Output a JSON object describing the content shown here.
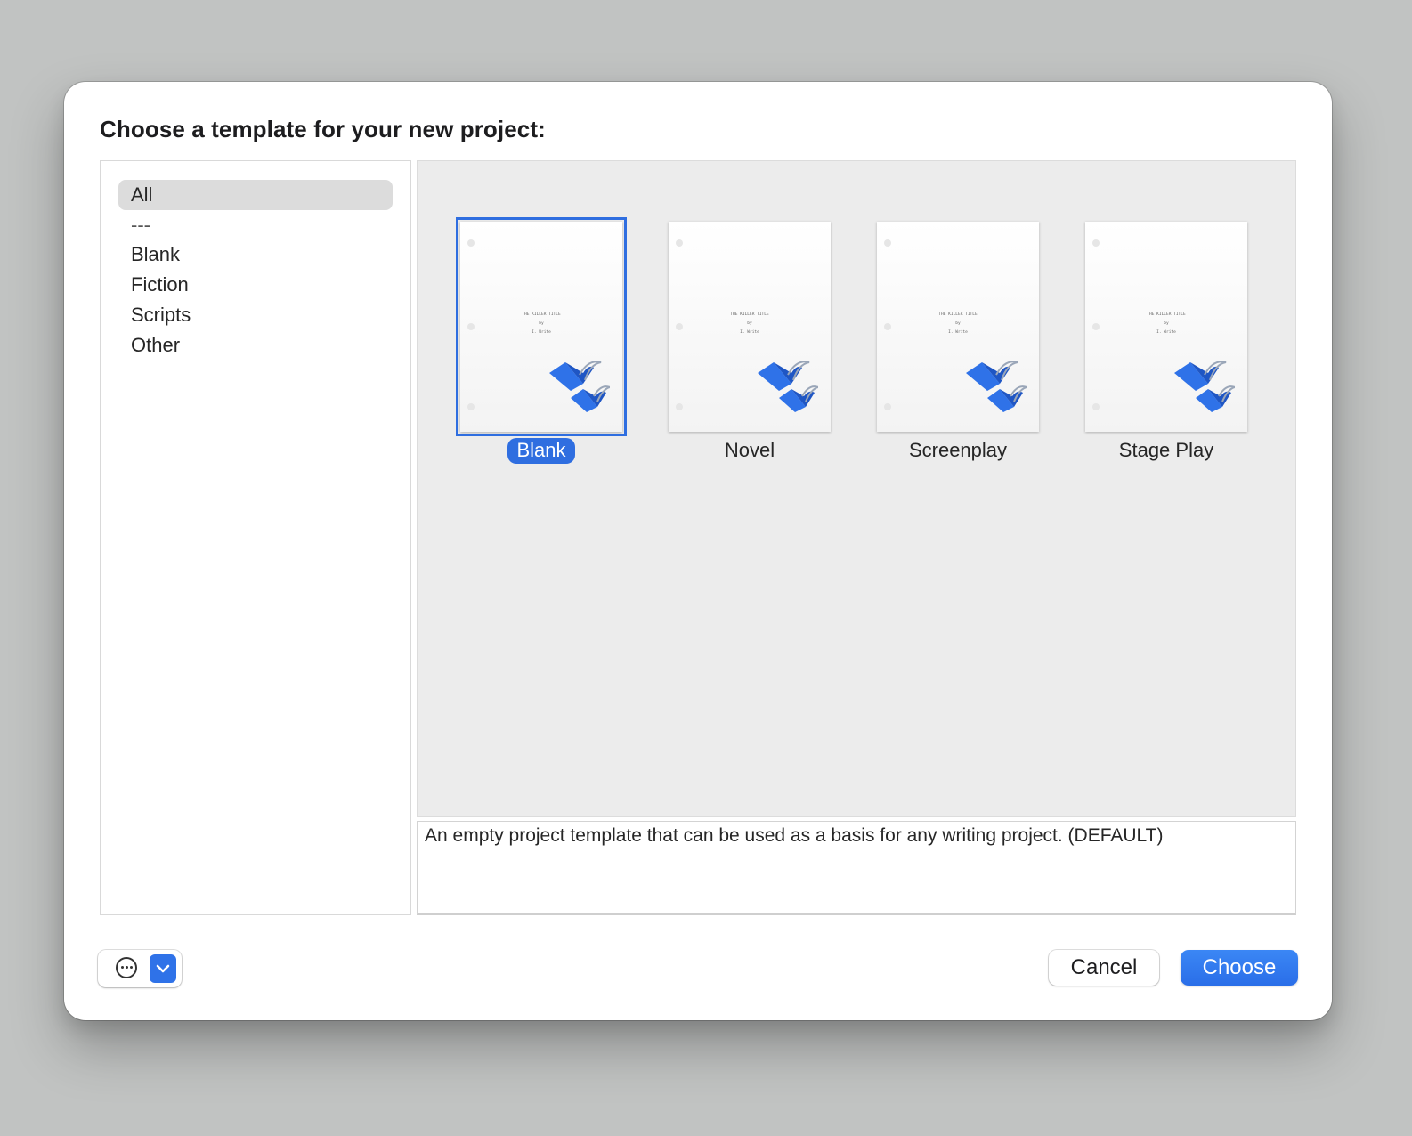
{
  "dialog": {
    "title": "Choose a template for your new project:"
  },
  "sidebar": {
    "categories": [
      {
        "label": "All",
        "selected": true
      },
      {
        "label": "---",
        "selected": false
      },
      {
        "label": "Blank",
        "selected": false
      },
      {
        "label": "Fiction",
        "selected": false
      },
      {
        "label": "Scripts",
        "selected": false
      },
      {
        "label": "Other",
        "selected": false
      }
    ]
  },
  "templates": [
    {
      "label": "Blank",
      "selected": true,
      "page_lines": [
        "THE KILLER TITLE",
        "by",
        "I. Write"
      ]
    },
    {
      "label": "Novel",
      "selected": false,
      "page_lines": [
        "THE KILLER TITLE",
        "by",
        "I. Write"
      ]
    },
    {
      "label": "Screenplay",
      "selected": false,
      "page_lines": [
        "THE KILLER TITLE",
        "by",
        "I. Write"
      ]
    },
    {
      "label": "Stage Play",
      "selected": false,
      "page_lines": [
        "THE KILLER TITLE",
        "by",
        "I. Write"
      ]
    }
  ],
  "description": "An empty project template that can be used as a basis for any writing project. (DEFAULT)",
  "footer": {
    "options_icon": "ellipsis-circle-icon",
    "dropdown_icon": "chevron-down-icon",
    "cancel_label": "Cancel",
    "choose_label": "Choose"
  },
  "colors": {
    "accent": "#2f6ee0",
    "window_backdrop": "#c1c3c2",
    "browser_bg": "#ececec"
  }
}
